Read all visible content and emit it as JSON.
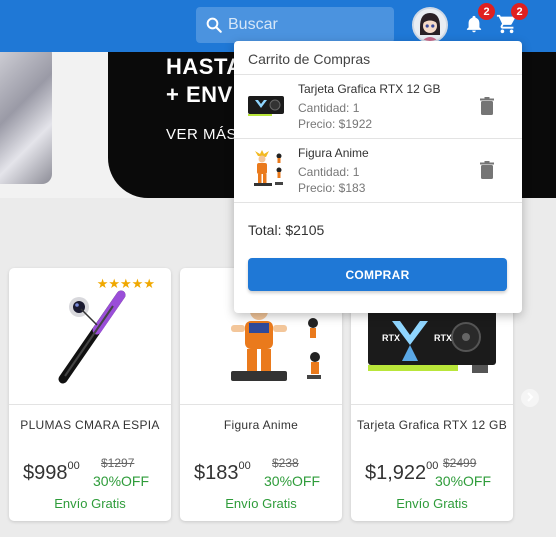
{
  "header": {
    "search_placeholder": "Buscar",
    "notifications_count": "2",
    "cart_count": "2"
  },
  "banner": {
    "line1": "HASTA",
    "line2": "+ ENV",
    "line3": "VER MÁS"
  },
  "products": [
    {
      "name": "PLUMAS CMARA ESPIA",
      "price_int": "$998",
      "price_dec": "00",
      "old_price": "$1297",
      "discount": "30%OFF",
      "shipping": "Envío Gratis",
      "rating_stars": "★★★★★",
      "image_icon": "spy-pen-icon"
    },
    {
      "name": "Figura Anime",
      "price_int": "$183",
      "price_dec": "00",
      "old_price": "$238",
      "discount": "30%OFF",
      "shipping": "Envío Gratis",
      "image_icon": "anime-figure-icon"
    },
    {
      "name": "Tarjeta Grafica RTX 12 GB",
      "price_int": "$1,922",
      "price_dec": "00",
      "old_price": "$2499",
      "discount": "30%OFF",
      "shipping": "Envío Gratis",
      "image_icon": "graphics-card-icon"
    }
  ],
  "cart": {
    "title": "Carrito de Compras",
    "items": [
      {
        "name": "Tarjeta Grafica RTX 12 GB",
        "qty": "Cantidad: 1",
        "price": "Precio: $1922",
        "image_icon": "graphics-card-icon"
      },
      {
        "name": "Figura Anime",
        "qty": "Cantidad: 1",
        "price": "Precio: $183",
        "image_icon": "anime-figure-icon"
      }
    ],
    "total": "Total: $2105",
    "buy_label": "COMPRAR"
  },
  "colors": {
    "primary": "#1f78d6",
    "badge": "#e02020",
    "success": "#2e9c3a",
    "star": "#f0a800"
  }
}
